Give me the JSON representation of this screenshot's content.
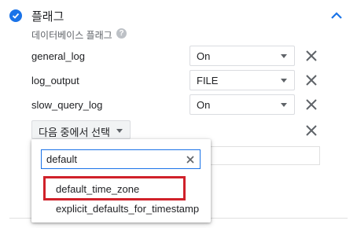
{
  "section": {
    "title": "플래그",
    "subtitle": "데이터베이스 플래그",
    "help_icon": "?"
  },
  "flags": [
    {
      "name": "general_log",
      "value": "On"
    },
    {
      "name": "log_output",
      "value": "FILE"
    },
    {
      "name": "slow_query_log",
      "value": "On"
    }
  ],
  "add_flag": {
    "button_label": "다음 중에서 선택"
  },
  "dropdown": {
    "search_value": "default",
    "options": [
      "default_time_zone",
      "explicit_defaults_for_timestamp"
    ],
    "highlighted_option": "default_time_zone"
  },
  "colors": {
    "accent": "#1a73e8",
    "highlight_border": "#d0212a"
  }
}
